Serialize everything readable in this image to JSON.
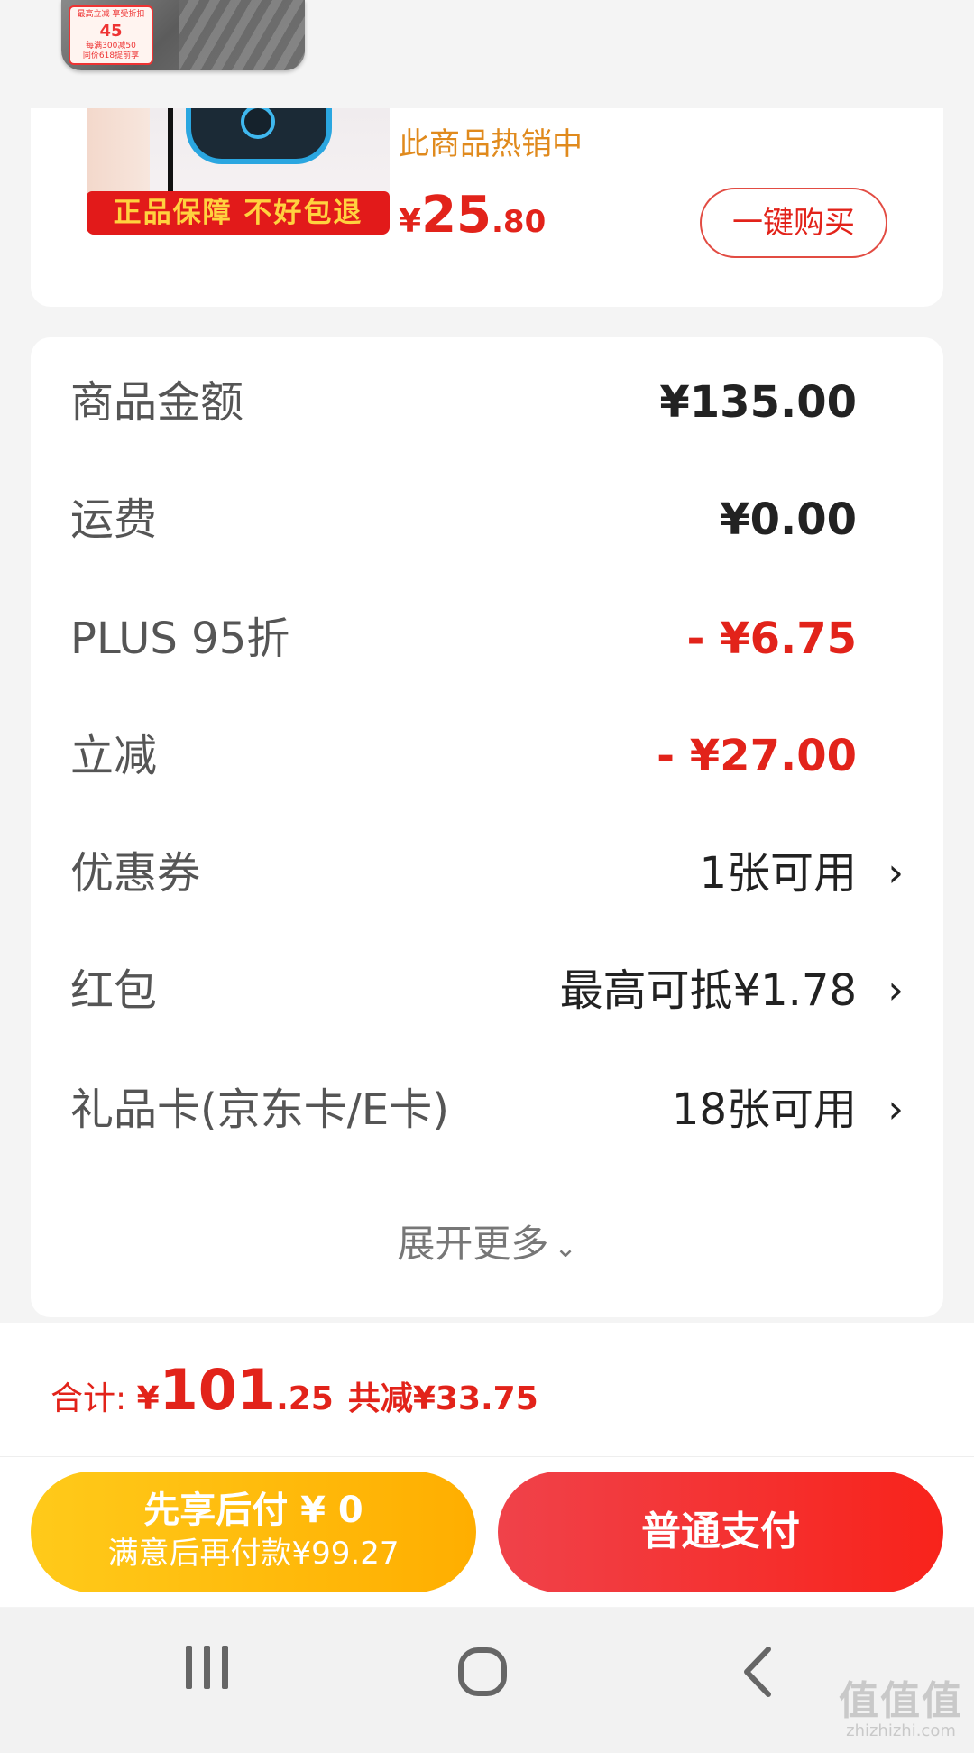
{
  "float_thumb": {
    "tag_top": "最高立减 享受折扣",
    "tag_price": "45",
    "tag_line2": "每满300减50",
    "tag_line3": "同价618提前享"
  },
  "product": {
    "banner": "正品保障 不好包退",
    "hot_text": "此商品热销中",
    "price_symbol": "¥",
    "price_int": "25",
    "price_dec": ".80",
    "buy_label": "一键购买"
  },
  "summary": {
    "rows": [
      {
        "label": "商品金额",
        "value": "¥135.00"
      },
      {
        "label": "运费",
        "value": "¥0.00"
      },
      {
        "label": "PLUS 95折",
        "value": "- ¥6.75"
      },
      {
        "label": "立减",
        "value": "- ¥27.00"
      },
      {
        "label": "优惠券",
        "value": "1张可用"
      },
      {
        "label": "红包",
        "value": "最高可抵¥1.78"
      },
      {
        "label": "礼品卡(京东卡/E卡)",
        "value": "18张可用"
      }
    ],
    "expand_label": "展开更多"
  },
  "total": {
    "label": "合计: ",
    "symbol": "¥",
    "int": "101",
    "dec": ".25",
    "saved": "共减¥33.75"
  },
  "actions": {
    "later_line1": "先享后付 ¥ 0",
    "later_line2": "满意后再付款¥99.27",
    "pay_label": "普通支付"
  },
  "watermark": {
    "main": "值值值",
    "sub": "zhizhizhi.com"
  },
  "colors": {
    "accent_red": "#e2231a",
    "hot_orange": "#e08a1d",
    "later_yellow": "#ffb400"
  }
}
